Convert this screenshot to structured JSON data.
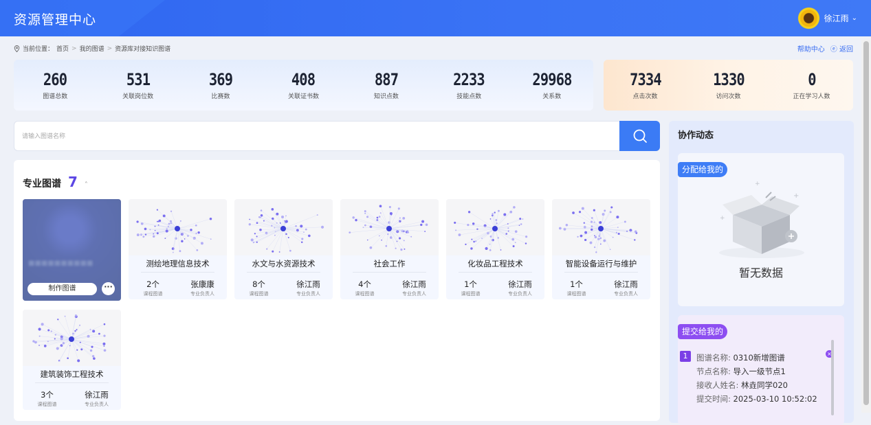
{
  "header": {
    "title": "资源管理中心",
    "user_name": "徐江雨",
    "avatar_icon": "sunflower-avatar"
  },
  "breadcrumb": {
    "prefix": "当前位置：",
    "items": [
      "首页",
      "我的图谱",
      "资源库对接知识图谱"
    ]
  },
  "help": {
    "help_label": "帮助中心",
    "back_label": "返回"
  },
  "stats_primary": [
    {
      "value": "260",
      "label": "图谱总数"
    },
    {
      "value": "531",
      "label": "关联岗位数"
    },
    {
      "value": "369",
      "label": "比赛数"
    },
    {
      "value": "408",
      "label": "关联证书数"
    },
    {
      "value": "887",
      "label": "知识点数"
    },
    {
      "value": "2233",
      "label": "技能点数"
    },
    {
      "value": "29968",
      "label": "关系数"
    }
  ],
  "stats_secondary": [
    {
      "value": "7334",
      "label": "点击次数"
    },
    {
      "value": "1330",
      "label": "访问次数"
    },
    {
      "value": "0",
      "label": "正在学习人数"
    }
  ],
  "search": {
    "placeholder": "请输入图谱名称"
  },
  "section": {
    "title": "专业图谱",
    "count": "7"
  },
  "cards": [
    {
      "name": "",
      "make_label": "制作图谱",
      "more_label": "···"
    },
    {
      "name": "测绘地理信息技术",
      "courses": "2个",
      "courses_label": "课程图谱",
      "owner": "张康康",
      "owner_label": "专业负责人"
    },
    {
      "name": "水文与水资源技术",
      "courses": "8个",
      "courses_label": "课程图谱",
      "owner": "徐江雨",
      "owner_label": "专业负责人"
    },
    {
      "name": "社会工作",
      "courses": "4个",
      "courses_label": "课程图谱",
      "owner": "徐江雨",
      "owner_label": "专业负责人"
    },
    {
      "name": "化妆品工程技术",
      "courses": "1个",
      "courses_label": "课程图谱",
      "owner": "徐江雨",
      "owner_label": "专业负责人"
    },
    {
      "name": "智能设备运行与维护",
      "courses": "1个",
      "courses_label": "课程图谱",
      "owner": "徐江雨",
      "owner_label": "专业负责人"
    },
    {
      "name": "建筑装饰工程技术",
      "courses": "3个",
      "courses_label": "课程图谱",
      "owner": "徐江雨",
      "owner_label": "专业负责人"
    }
  ],
  "side": {
    "title": "协作动态",
    "assigned_tag": "分配给我的",
    "empty_text": "暂无数据",
    "submitted_tag": "提交给我的",
    "items": [
      {
        "index": "1",
        "graph_label": "图谱名称:",
        "graph_value": "0310新增图谱",
        "node_label": "节点名称:",
        "node_value": "导入一级节点1",
        "receiver_label": "接收人姓名:",
        "receiver_value": "林垚同学020",
        "time_label": "提交时间:",
        "time_value": "2025-03-10 10:52:02"
      }
    ]
  },
  "colors": {
    "brand_blue": "#3b7bf5",
    "count_purple": "#5c47e4",
    "tag_purple": "#8d4ef1"
  }
}
